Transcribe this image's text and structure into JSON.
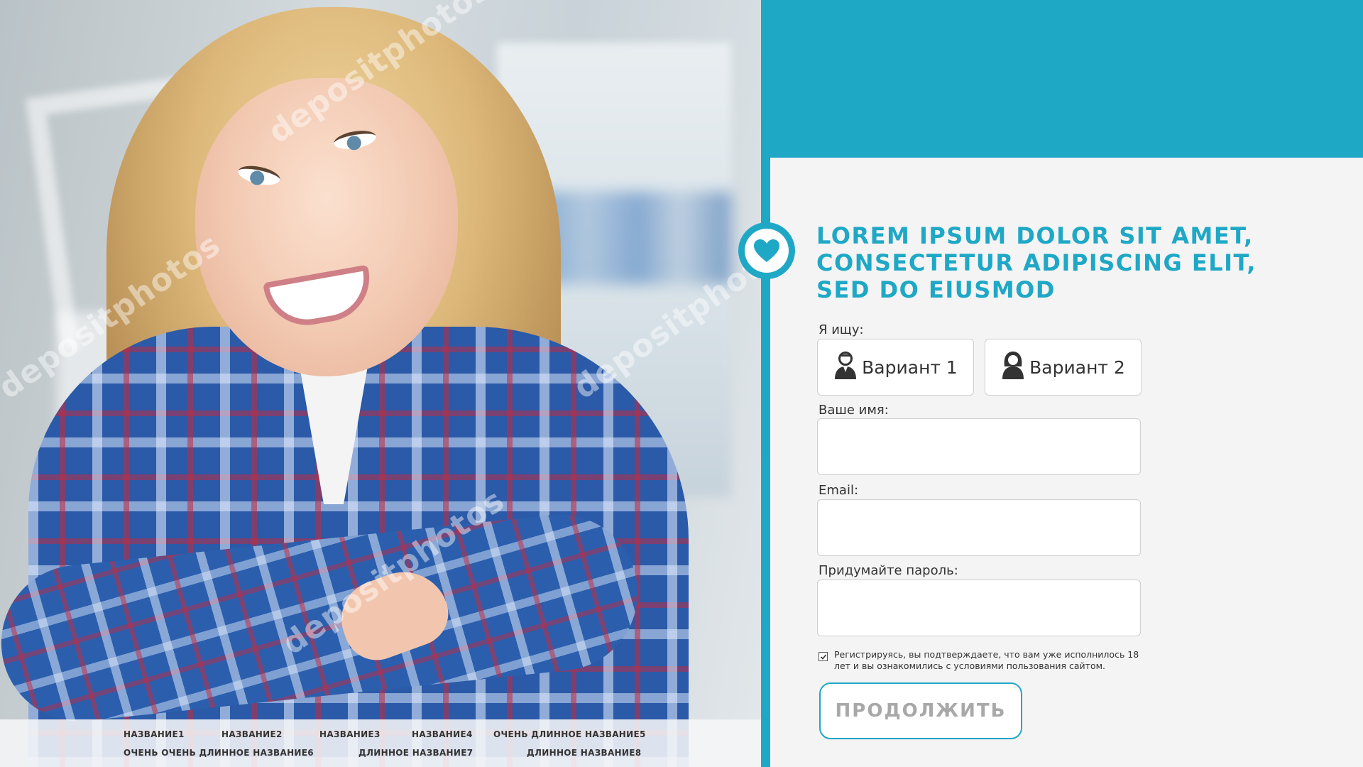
{
  "hero": {
    "watermark": "depositphotos"
  },
  "nav": {
    "items": [
      "НАЗВАНИЕ1",
      "НАЗВАНИЕ2",
      "НАЗВАНИЕ3",
      "НАЗВАНИЕ4",
      "ОЧЕНЬ ДЛИННОЕ НАЗВАНИЕ5",
      "ОЧЕНЬ ОЧЕНЬ ДЛИННОЕ НАЗВАНИЕ6",
      "ДЛИННОЕ НАЗВАНИЕ7",
      "ДЛИННОЕ НАЗВАНИЕ8"
    ]
  },
  "form": {
    "headline": [
      "LOREM IPSUM DOLOR SIT AMET,",
      "CONSECTETUR ADIPISCING ELIT,",
      "SED DO EIUSMOD"
    ],
    "seeking_label": "Я ищу:",
    "option1": "Вариант 1",
    "option2": "Вариант 2",
    "name_label": "Ваше имя:",
    "name_value": "",
    "email_label": "Email:",
    "email_value": "",
    "password_label": "Придумайте пароль:",
    "password_value": "",
    "agree_text": "Регистрируясь, вы подтверждаете, что вам уже исполнилось 18 лет и вы ознакомились с условиями пользования сайтом.",
    "agree_checked": true,
    "submit_label": "ПРОДОЛЖИТЬ"
  },
  "colors": {
    "accent": "#1fa8c6",
    "panel_bg": "#f4f4f4",
    "text": "#333333",
    "button_text": "#a8a8a8"
  },
  "icons": {
    "badge": "heart-icon",
    "option1": "male-user-icon",
    "option2": "female-user-icon",
    "checkbox": "check-icon"
  }
}
